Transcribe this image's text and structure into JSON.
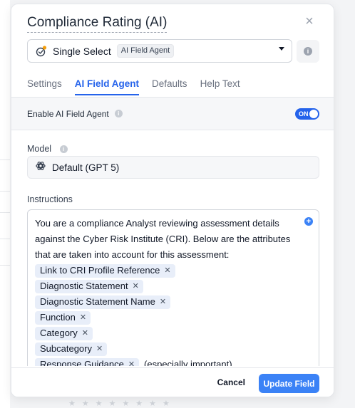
{
  "dialog": {
    "title": "Compliance Rating (AI)",
    "close_icon": "×",
    "field_type": {
      "label": "Single Select",
      "badge": "AI Field Agent",
      "icon": "single-select-icon"
    },
    "info_icon": "i"
  },
  "tabs": [
    {
      "label": "Settings",
      "active": false
    },
    {
      "label": "AI Field Agent",
      "active": true
    },
    {
      "label": "Defaults",
      "active": false
    },
    {
      "label": "Help Text",
      "active": false
    }
  ],
  "toggle": {
    "label": "Enable AI Field Agent",
    "state_text": "ON",
    "enabled": true
  },
  "model": {
    "label": "Model",
    "value": "Default (GPT 5)",
    "icon": "openai-icon"
  },
  "instructions": {
    "label": "Instructions",
    "lines": [
      "You are a compliance Analyst reviewing assessment details",
      "against the Cyber Risk Institute (CRI). Below are the attributes",
      "that are taken into account for this assessment:"
    ],
    "attributes": [
      {
        "label": "Link to CRI Profile Reference",
        "suffix": ""
      },
      {
        "label": "Diagnostic Statement",
        "suffix": ""
      },
      {
        "label": "Diagnostic Statement Name",
        "suffix": ""
      },
      {
        "label": "Function",
        "suffix": ""
      },
      {
        "label": "Category",
        "suffix": ""
      },
      {
        "label": "Subcategory",
        "suffix": ""
      },
      {
        "label": "Response Guidance",
        "suffix": "(especially important)"
      }
    ],
    "add_icon": "+"
  },
  "footer": {
    "cancel_label": "Cancel",
    "update_label": "Update Field"
  },
  "colors": {
    "accent": "#3b82f6",
    "tab_active": "#2563eb",
    "chip_bg": "#e8eef9"
  }
}
